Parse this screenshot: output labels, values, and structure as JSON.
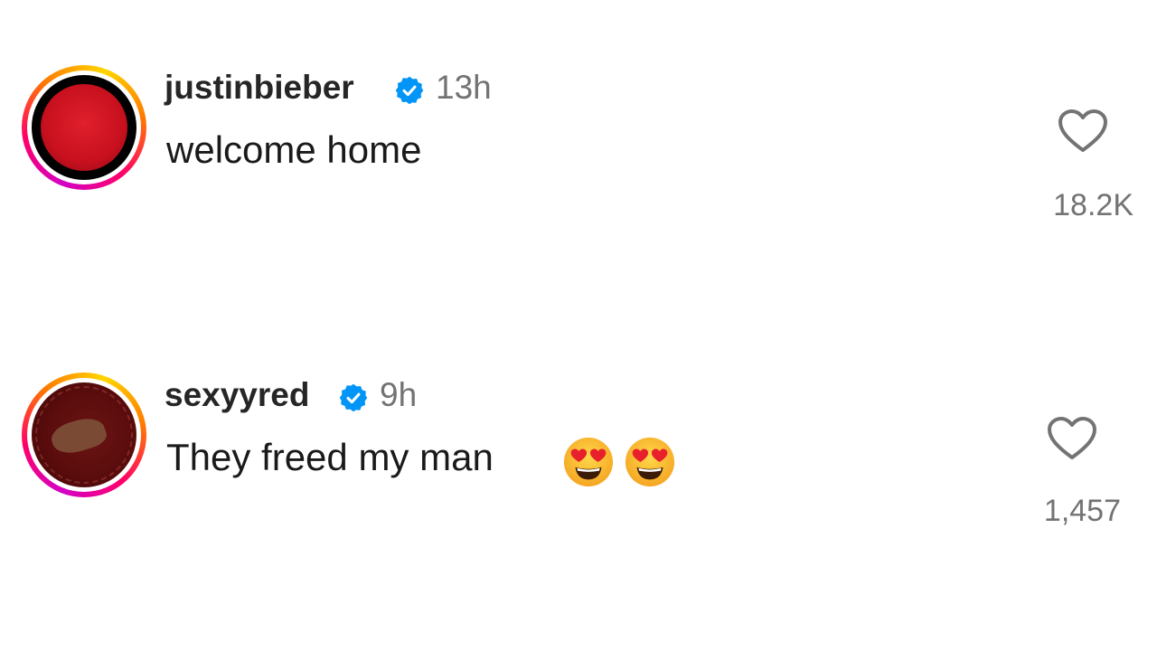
{
  "comments": [
    {
      "username": "justinbieber",
      "verified": true,
      "time": "13h",
      "text": "welcome home",
      "likes": "18.2K",
      "avatar": "red-circle-avatar"
    },
    {
      "username": "sexyyred",
      "verified": true,
      "time": "9h",
      "text": "They freed my man",
      "emojis": [
        "heart-eyes-emoji",
        "heart-eyes-emoji"
      ],
      "likes": "1,457",
      "avatar": "photo-avatar"
    }
  ],
  "colors": {
    "verified_blue": "#0095f6",
    "muted_text": "#737373",
    "username_text": "#262626"
  }
}
